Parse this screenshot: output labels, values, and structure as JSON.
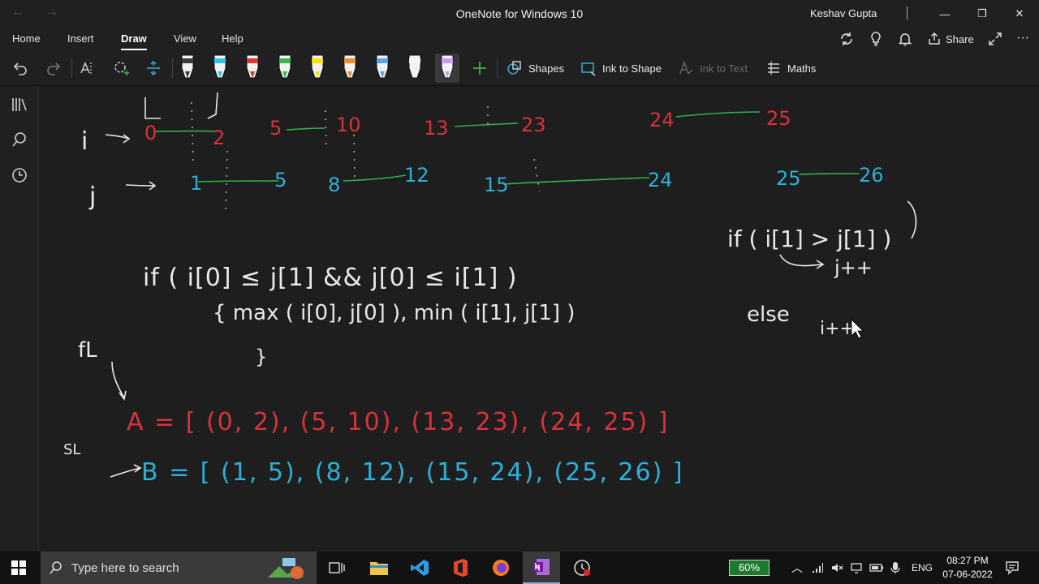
{
  "titlebar": {
    "title": "OneNote for Windows 10",
    "user": "Keshav Gupta",
    "back_glyph": "←",
    "forward_glyph": "→",
    "minimize_glyph": "—",
    "restore_glyph": "❐",
    "close_glyph": "✕"
  },
  "tabs": [
    "Home",
    "Insert",
    "Draw",
    "View",
    "Help"
  ],
  "active_tab": "Draw",
  "header_right": {
    "share_label": "Share",
    "more_glyph": "···"
  },
  "toolbar": {
    "shapes_label": "Shapes",
    "ink_to_shape_label": "Ink to Shape",
    "ink_to_text_label": "Ink to Text",
    "maths_label": "Maths",
    "pens": [
      {
        "name": "pen-black",
        "color": "#3a3a3a"
      },
      {
        "name": "pen-cyan",
        "color": "#2ec4e6"
      },
      {
        "name": "pen-red",
        "color": "#e0312f"
      },
      {
        "name": "pen-green",
        "color": "#39b54a"
      },
      {
        "name": "highlighter-yellow",
        "color": "#f3e400"
      },
      {
        "name": "pen-orange",
        "color": "#f08a2a"
      },
      {
        "name": "pen-lightblue",
        "color": "#5aa7e8"
      },
      {
        "name": "pen-white",
        "color": "#f5f5f5"
      },
      {
        "name": "pen-purple",
        "color": "#c79ee8"
      }
    ]
  },
  "colors": {
    "ink_white": "#e9e9e9",
    "ink_red": "#d8323a",
    "ink_blue": "#2bb0d8",
    "ink_green": "#2fb14a",
    "taskbar": "#121212",
    "battery_green": "#1c7a2c"
  },
  "ink": {
    "row1_labels": [
      "0",
      "2",
      "5",
      "10",
      "13",
      "23",
      "24",
      "25"
    ],
    "row2_labels": [
      "1",
      "5",
      "8",
      "12",
      "15",
      "24",
      "25",
      "26"
    ],
    "label_i": "i",
    "label_j": "j",
    "arrow_glyph": "→",
    "condition_line1": "if ( i[0] ≤ j[1]  && j[0] ≤ i[1] )",
    "condition_line2": "{ max ( i[0], j[0] ),  min ( i[1], j[1] )",
    "close_brace": "}",
    "fl_label": "fL",
    "sl_label": "SL",
    "array_a": "A = [ (0, 2), (5, 10), (13, 23), (24, 25) ]",
    "array_b": "B = [ (1, 5), (8, 12), (15, 24), (25, 26) ]",
    "right_cond": "if ( i[1] > j[1] )",
    "right_then": "j++",
    "right_else": "else",
    "right_else_do": "i++"
  },
  "taskbar": {
    "search_placeholder": "Type here to search",
    "battery": "60%",
    "language": "ENG",
    "time": "08:27 PM",
    "date": "07-06-2022"
  }
}
